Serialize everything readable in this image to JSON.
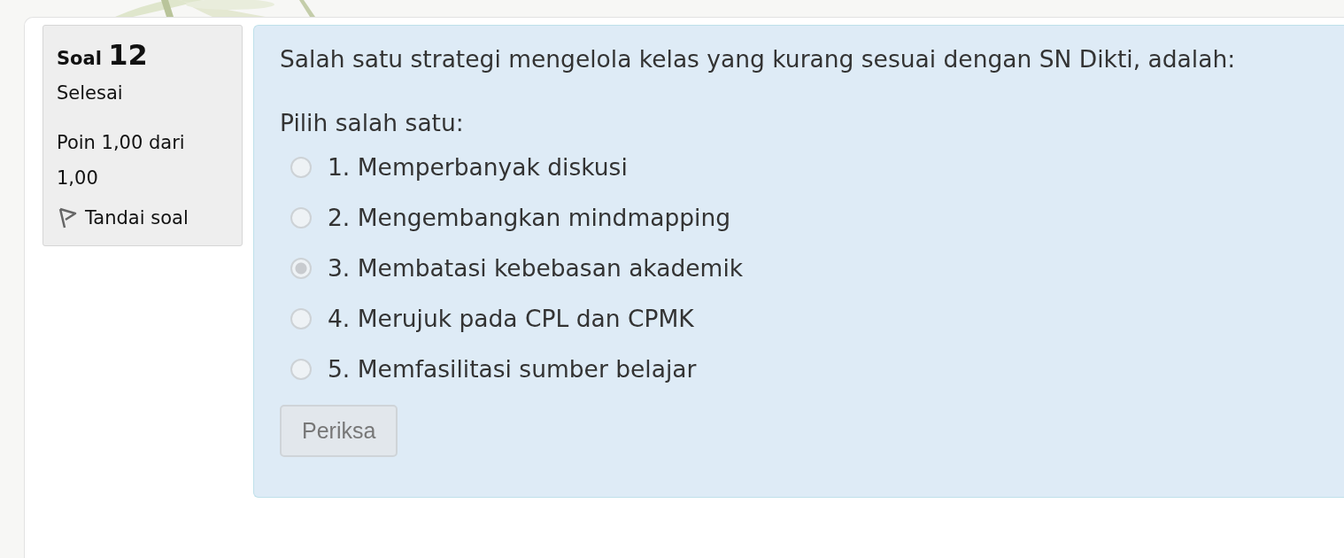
{
  "question_info": {
    "label": "Soal",
    "number": "12",
    "state": "Selesai",
    "grade": "Poin 1,00 dari 1,00",
    "flag_label": "Tandai soal"
  },
  "question": {
    "text": "Salah satu strategi mengelola kelas yang kurang sesuai dengan SN Dikti, adalah:",
    "prompt": "Pilih salah satu:",
    "options": [
      {
        "label": "1. Memperbanyak diskusi",
        "selected": false
      },
      {
        "label": "2. Mengembangkan mindmapping",
        "selected": false
      },
      {
        "label": "3. Membatasi kebebasan akademik",
        "selected": true
      },
      {
        "label": "4. Merujuk pada CPL dan CPMK",
        "selected": false
      },
      {
        "label": "5. Memfasilitasi sumber belajar",
        "selected": false
      }
    ],
    "check_button": {
      "label": "Periksa",
      "disabled": true
    }
  }
}
